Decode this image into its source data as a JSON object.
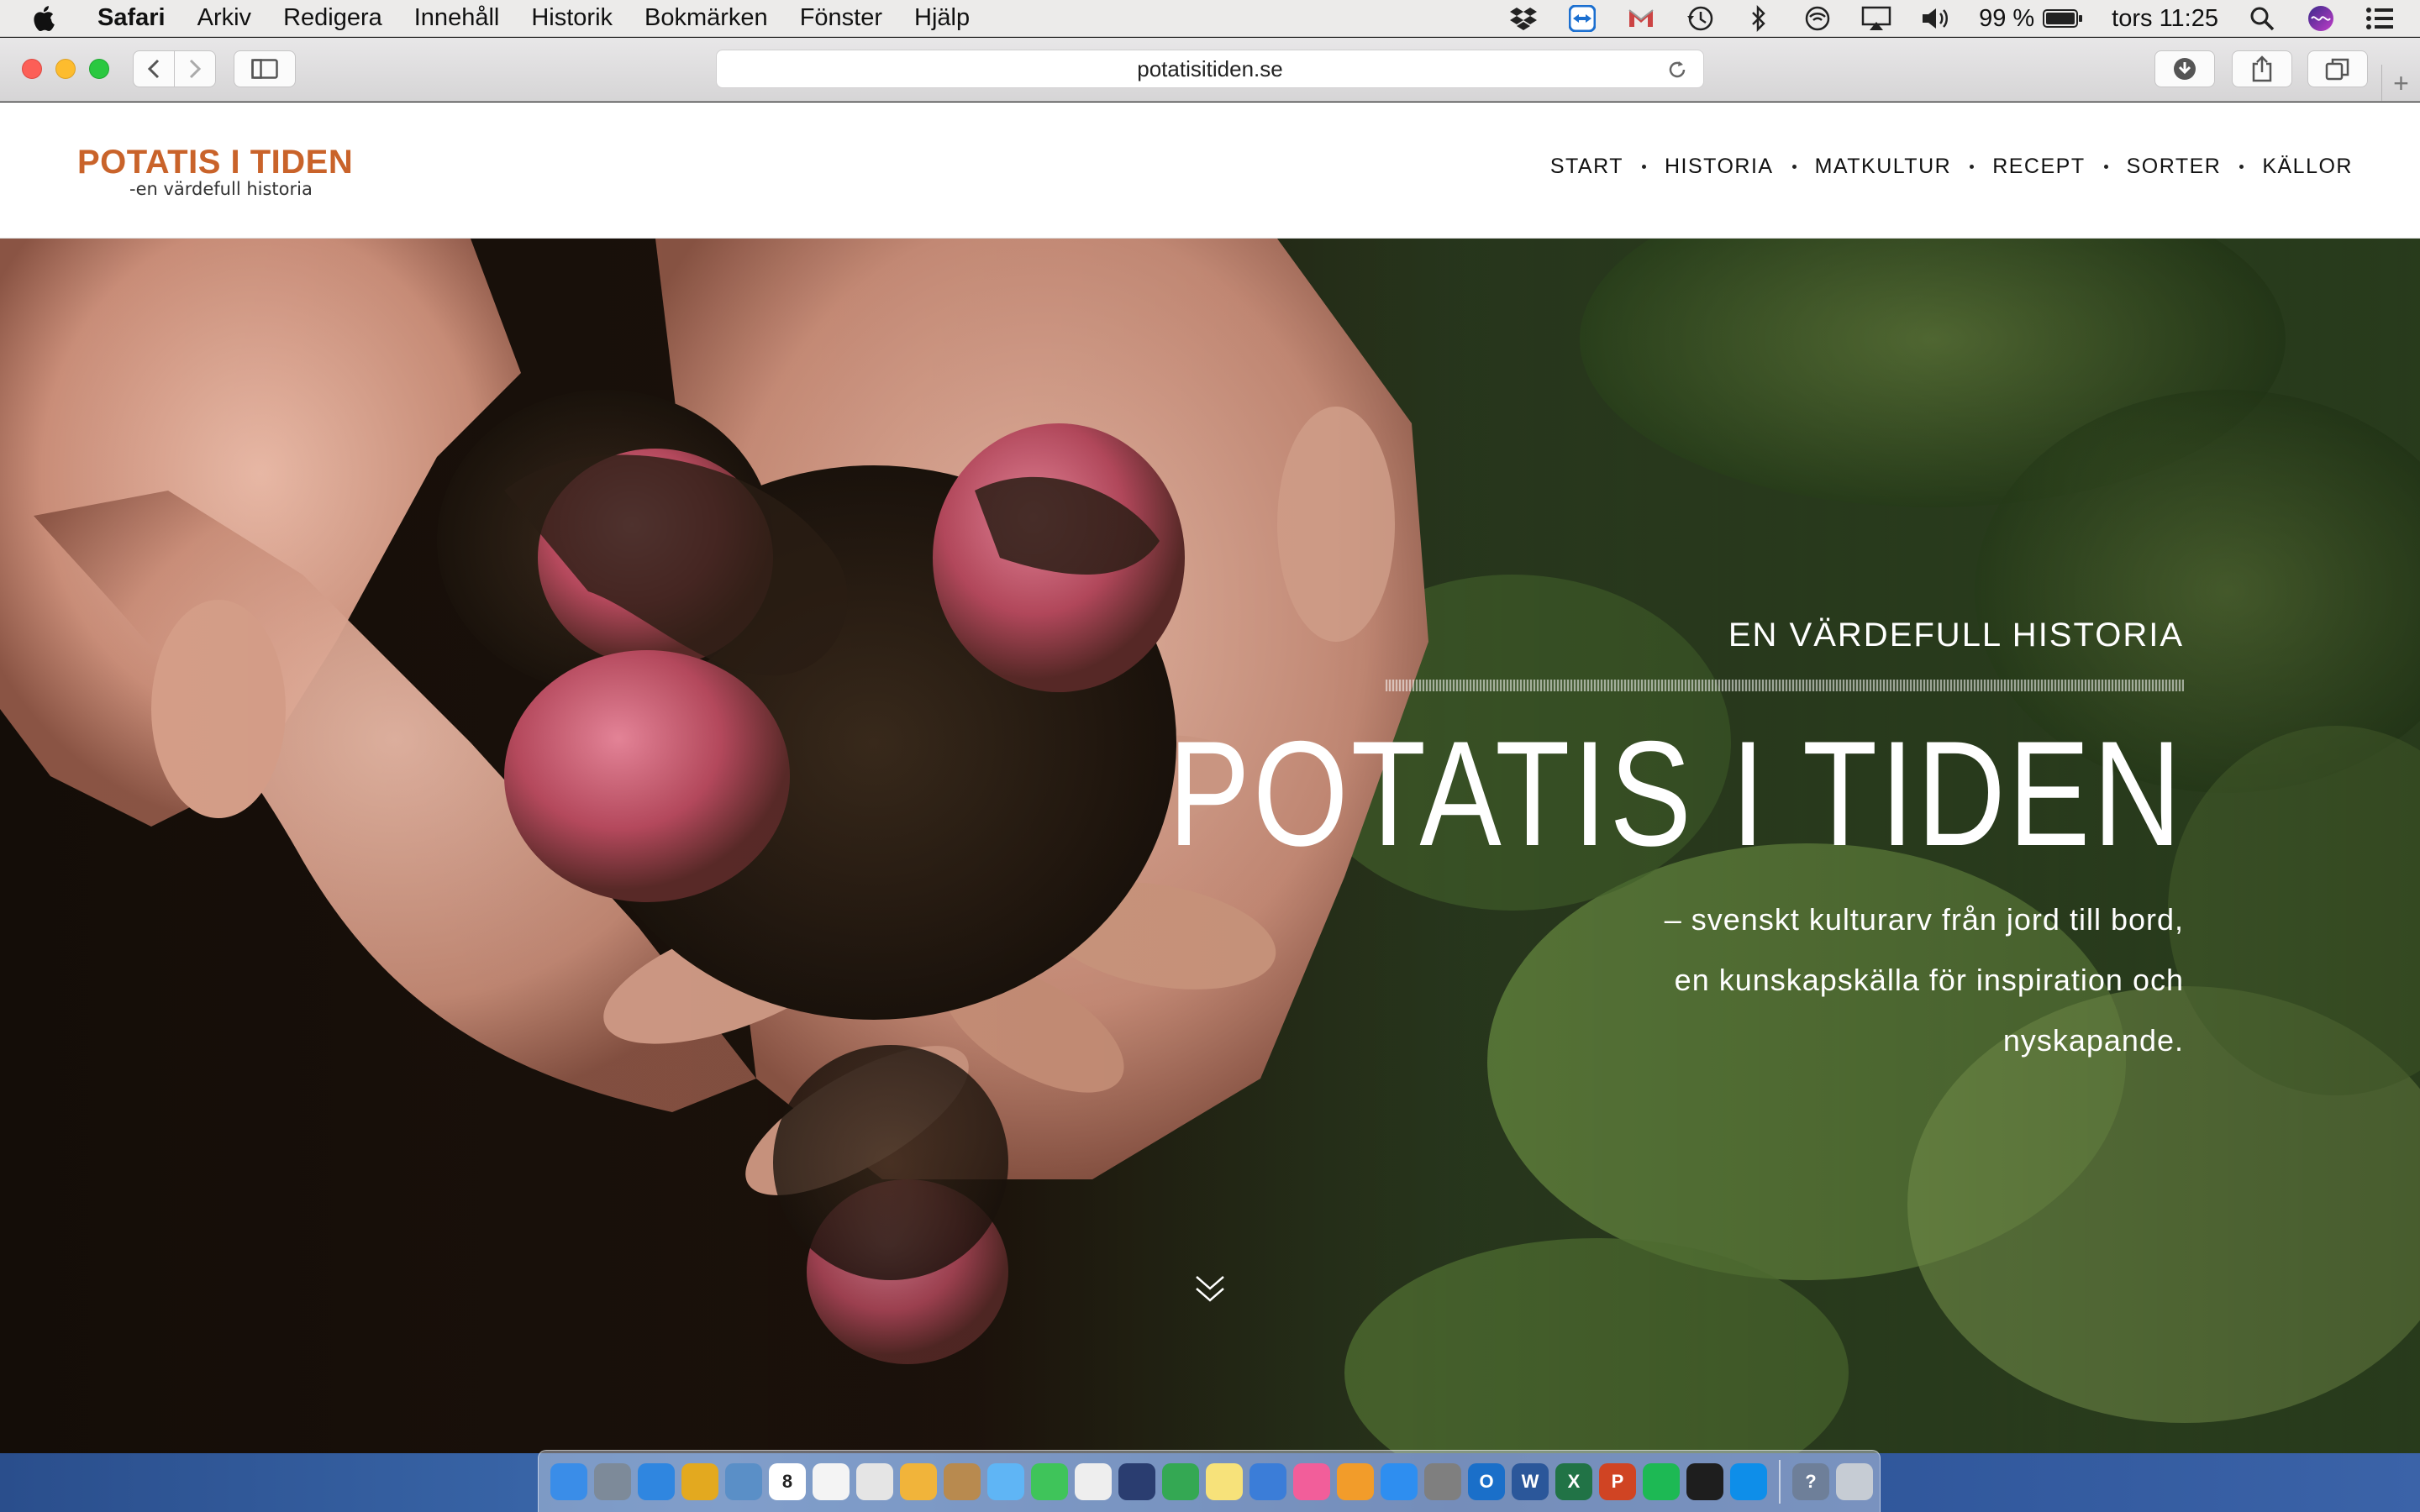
{
  "menubar": {
    "app_name": "Safari",
    "items": [
      "Arkiv",
      "Redigera",
      "Innehåll",
      "Historik",
      "Bokmärken",
      "Fönster",
      "Hjälp"
    ],
    "battery": "99 %",
    "clock": "tors 11:25",
    "status_icons": [
      "dropbox-icon",
      "teamviewer-icon",
      "gmail-icon",
      "time-machine-icon",
      "bluetooth-icon",
      "wifi-icon",
      "airplay-icon",
      "volume-icon",
      "battery-icon",
      "spotlight-icon",
      "siri-icon",
      "notification-center-icon"
    ]
  },
  "browser": {
    "url": "potatisitiden.se",
    "new_tab_label": "+"
  },
  "site": {
    "logo_title": "POTATIS I TIDEN",
    "logo_subtitle": "-en värdefull historia",
    "nav": [
      "START",
      "HISTORIA",
      "MATKULTUR",
      "RECEPT",
      "SORTER",
      "KÄLLOR"
    ],
    "brand_color": "#c9632a"
  },
  "hero": {
    "eyebrow": "EN VÄRDEFULL HISTORIA",
    "title": "POTATIS I TIDEN",
    "subtitle_lines": [
      "– svenskt kulturarv från jord till bord,",
      "en kunskapskälla för inspiration och",
      "nyskapande."
    ],
    "image_alt": "hands-holding-potatoes-photo",
    "scroll_hint_icon": "chevron-down-icon"
  },
  "dock": {
    "apps": [
      {
        "name": "finder",
        "color": "#3a8de8"
      },
      {
        "name": "launchpad",
        "color": "#7d8a99"
      },
      {
        "name": "safari",
        "color": "#2f86e0"
      },
      {
        "name": "chrome",
        "color": "#e3a91f"
      },
      {
        "name": "preview",
        "color": "#5a8fc7"
      },
      {
        "name": "calendar",
        "color": "#ffffff",
        "label": "8"
      },
      {
        "name": "reminders",
        "color": "#f4f4f4"
      },
      {
        "name": "notes-board",
        "color": "#e5e5e5"
      },
      {
        "name": "photos",
        "color": "#f1b43a"
      },
      {
        "name": "contacts",
        "color": "#b88a4f"
      },
      {
        "name": "messages",
        "color": "#5fb5f5"
      },
      {
        "name": "facetime",
        "color": "#3fc45a"
      },
      {
        "name": "textedit",
        "color": "#eeeeee"
      },
      {
        "name": "network-radar",
        "color": "#2a3d70"
      },
      {
        "name": "numbers",
        "color": "#34a853"
      },
      {
        "name": "notes",
        "color": "#f7e27a"
      },
      {
        "name": "keynote",
        "color": "#3b7dd8"
      },
      {
        "name": "itunes",
        "color": "#f25e9a"
      },
      {
        "name": "ibooks",
        "color": "#f29c2a"
      },
      {
        "name": "app-store",
        "color": "#2e8ef0"
      },
      {
        "name": "system-preferences",
        "color": "#7f7f7f"
      },
      {
        "name": "outlook",
        "color": "#1a6fc9",
        "label": "O"
      },
      {
        "name": "word",
        "color": "#2b579a",
        "label": "W"
      },
      {
        "name": "excel",
        "color": "#217346",
        "label": "X"
      },
      {
        "name": "powerpoint",
        "color": "#d04423",
        "label": "P"
      },
      {
        "name": "spotify",
        "color": "#1db954"
      },
      {
        "name": "activity-monitor",
        "color": "#1e1e1e"
      },
      {
        "name": "teamviewer",
        "color": "#0e8ee9"
      },
      {
        "name": "help",
        "color": "#6e7f99",
        "label": "?"
      },
      {
        "name": "trash",
        "color": "#c6ccd4"
      }
    ]
  }
}
